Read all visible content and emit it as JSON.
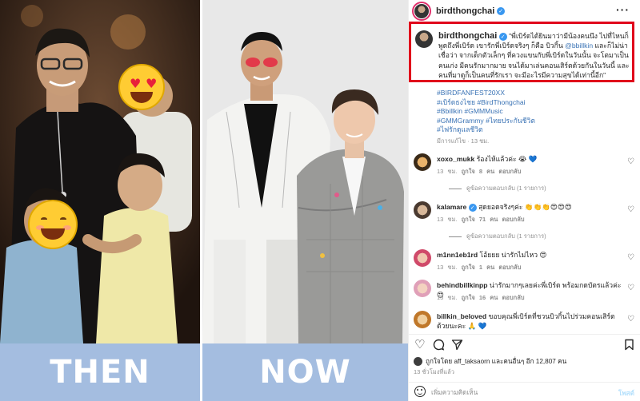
{
  "photo": {
    "then_label": "THEN",
    "now_label": "NOW",
    "emojis": [
      "smiling-face-with-heart-eyes",
      "smiling-face"
    ]
  },
  "post": {
    "header": {
      "username": "birdthongchai",
      "verified": true,
      "more_icon": "more-options-icon"
    },
    "caption": {
      "username": "birdthongchai",
      "text_parts": [
        "\"พี่เบิร์ดได้ยินมาว่ามีน้องคนนึง ไปที่ไหนก็พูดถึงพี่เบิร์ด เขารักพี่เบิร์ดจริงๆ ก็คือ บิวกิ้น ",
        "@bbillkin",
        " และก็ไม่น่าเชื่อว่า จากเด็กตัวเล็กๆ ที่ควงแขนกับพี่เบิร์ดในวันนั้น จะโตมาเป็นคนเก่ง มีคนรักมากมาย จนได้มาเล่นคอนเสิร์ตด้วยกันในวันนี้ และคนที่มาดูก็เป็นคนที่รักเรา จะมีอะไรมีความสุขได้เท่านี้อีก\""
      ]
    },
    "hashtags": "#BIRDFANFEST20XX\n#เบิร์ดธงไชย #BirdThongchai\n#Bbillkin #GMMMusic\n#GMMGrammy #ไทยประกันชีวิต\n#ไฟรักดูแลชีวิต",
    "edited_time": "มีการแก้ไข · 13 ชม.",
    "comments": [
      {
        "username": "xoxo_mukk",
        "text": "ร้องไห้แล้วค่ะ 😭 💙",
        "time": "13 ชม.",
        "likes": "ถูกใจ 8 คน",
        "reply": "ตอบกลับ",
        "replies": "ดูข้อความตอบกลับ (1 รายการ)"
      },
      {
        "username": "kalamare",
        "text": "สุดยอดจริงๆค่ะ 👏👏👏😍😍😍",
        "time": "13 ชม.",
        "likes": "ถูกใจ 71 คน",
        "reply": "ตอบกลับ",
        "replies": "ดูข้อความตอบกลับ (1 รายการ)"
      },
      {
        "username": "m1nn1eb1rd",
        "text": "โอ้ยยย น่ารักไม่ไหว 😍",
        "time": "13 ชม.",
        "likes": "ถูกใจ 1 คน",
        "reply": "ตอบกลับ"
      },
      {
        "username": "behindbillkinpp",
        "text": "น่ารักมากๆเลยค่ะพี่เบิร์ด พร้อมกดบัตรแล้วค่ะ 😍",
        "time": "13 ชม.",
        "likes": "ถูกใจ 16 คน",
        "reply": "ตอบกลับ"
      },
      {
        "username": "billkin_beloved",
        "text": "ขอบคุณพี่เบิร์ดที่ชวนบิวกิ้นไปร่วมคอนเสิร์ตด้วยนะคะ 🙏 💙",
        "time": "",
        "likes": "",
        "reply": ""
      }
    ],
    "actions": [
      "heart-icon",
      "comment-icon",
      "share-icon",
      "bookmark-icon"
    ],
    "likes_line": "ถูกใจโดย aff_taksaorn และคนอื่นๆ อีก 12,807 คน",
    "post_time": "13 ชั่วโมงที่แล้ว",
    "add_comment": {
      "placeholder": "เพิ่มความคิดเห็น",
      "post_label": "โพสต์"
    }
  },
  "colors": {
    "highlight_border": "#e0001b",
    "caption_bar": "#a4bde0",
    "link": "#3a73b5",
    "verified": "#3897f0"
  }
}
